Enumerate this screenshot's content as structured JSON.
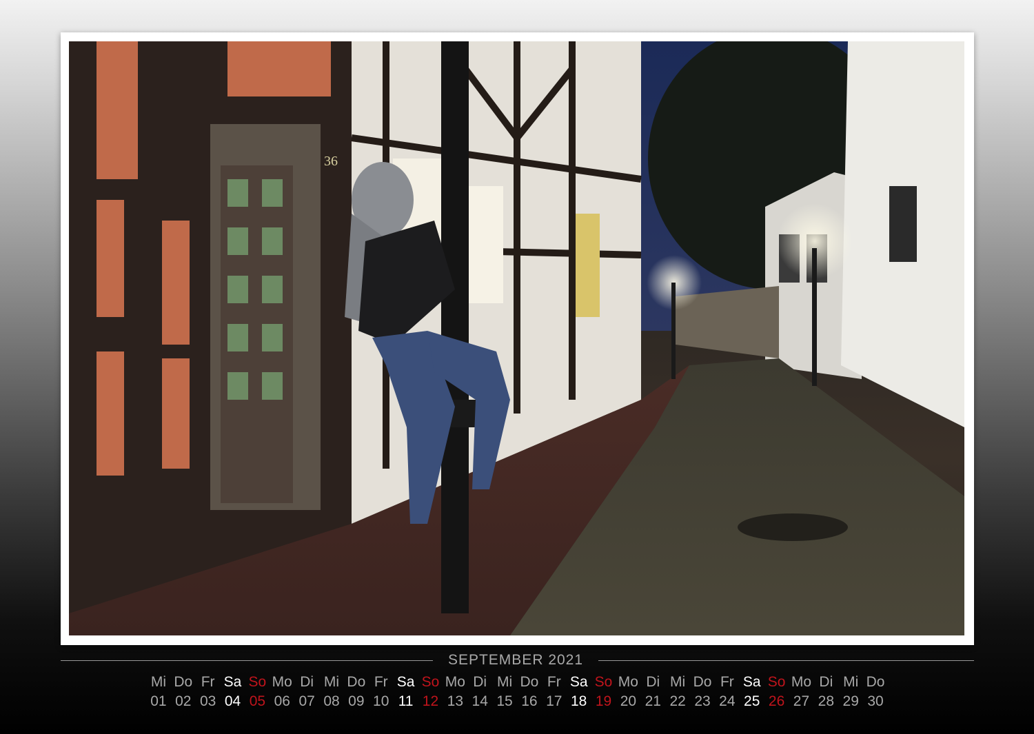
{
  "calendar": {
    "month_title": "SEPTEMBER 2021",
    "weekdays": [
      "Mi",
      "Do",
      "Fr",
      "Sa",
      "So",
      "Mo",
      "Di",
      "Mi",
      "Do",
      "Fr",
      "Sa",
      "So",
      "Mo",
      "Di",
      "Mi",
      "Do",
      "Fr",
      "Sa",
      "So",
      "Mo",
      "Di",
      "Mi",
      "Do",
      "Fr",
      "Sa",
      "So",
      "Mo",
      "Di",
      "Mi",
      "Do"
    ],
    "days": [
      "01",
      "02",
      "03",
      "04",
      "05",
      "06",
      "07",
      "08",
      "09",
      "10",
      "11",
      "12",
      "13",
      "14",
      "15",
      "16",
      "17",
      "18",
      "19",
      "20",
      "21",
      "22",
      "23",
      "24",
      "25",
      "26",
      "27",
      "28",
      "29",
      "30"
    ],
    "saturday_color": "#ffffff",
    "sunday_color": "#c0141c",
    "weekday_color": "#a8a8a8"
  },
  "photo": {
    "house_number": "36"
  }
}
